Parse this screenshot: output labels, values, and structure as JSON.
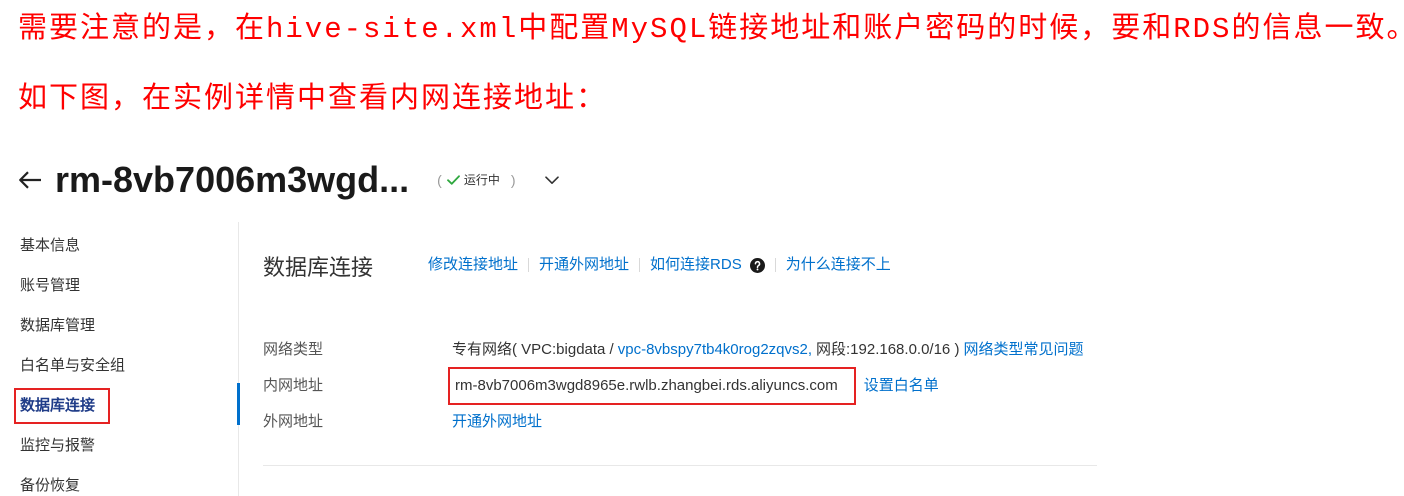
{
  "article": {
    "note": "需要注意的是，在hive-site.xml中配置MySQL链接地址和账户密码的时候，要和RDS的信息一致。",
    "intro": "如下图，在实例详情中查看内网连接地址："
  },
  "header": {
    "back_icon": "arrow-left-icon",
    "instance_name": "rm-8vb7006m3wgd...",
    "status": {
      "open": "(",
      "icon": "check-icon",
      "label": "运行中",
      "close": ")"
    },
    "dropdown_icon": "chevron-down-icon"
  },
  "sidebar": {
    "items": [
      {
        "label": "基本信息",
        "active": false
      },
      {
        "label": "账号管理",
        "active": false
      },
      {
        "label": "数据库管理",
        "active": false
      },
      {
        "label": "白名单与安全组",
        "active": false
      },
      {
        "label": "数据库连接",
        "active": true
      },
      {
        "label": "监控与报警",
        "active": false
      },
      {
        "label": "备份恢复",
        "active": false
      }
    ]
  },
  "connection": {
    "title": "数据库连接",
    "actions": [
      {
        "label": "修改连接地址"
      },
      {
        "label": "开通外网地址"
      },
      {
        "label": "如何连接RDS",
        "icon": "question-circle-icon"
      },
      {
        "label": "为什么连接不上"
      }
    ],
    "network_type": {
      "label": "网络类型",
      "prefix": "专有网络( VPC:bigdata /",
      "vpc_id": "vpc-8vbspy7tb4k0rog2zqvs2,",
      "segment": "网段:192.168.0.0/16 )",
      "faq_link": "网络类型常见问题"
    },
    "internal_address": {
      "label": "内网地址",
      "value": "rm-8vb7006m3wgd8965e.rwlb.zhangbei.rds.aliyuncs.com",
      "whitelist_link": "设置白名单"
    },
    "public_address": {
      "label": "外网地址",
      "enable_link": "开通外网地址"
    }
  },
  "colors": {
    "note_text": "#ff0000",
    "link": "#0070cc",
    "status_ok": "#2fa83f",
    "highlight_box": "#e52222",
    "active_menu": "#1f3c88",
    "active_indicator": "#0070cc"
  }
}
